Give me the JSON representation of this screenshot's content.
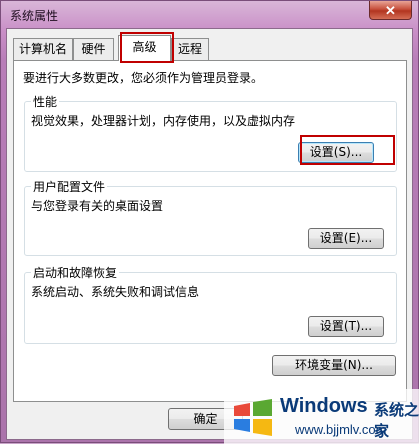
{
  "window": {
    "title": "系统属性",
    "close_label": "✕"
  },
  "tabs": [
    {
      "label": "计算机名"
    },
    {
      "label": "硬件"
    },
    {
      "label": "高级"
    },
    {
      "label": "远程"
    }
  ],
  "panel": {
    "intro": "要进行大多数更改，您必须作为管理员登录。",
    "groups": [
      {
        "title": "性能",
        "desc": "视觉效果，处理器计划，内存使用，以及虚拟内存",
        "button": "设置(S)..."
      },
      {
        "title": "用户配置文件",
        "desc": "与您登录有关的桌面设置",
        "button": "设置(E)..."
      },
      {
        "title": "启动和故障恢复",
        "desc": "系统启动、系统失败和调试信息",
        "button": "设置(T)..."
      }
    ],
    "env_button": "环境变量(N)..."
  },
  "footer": {
    "ok_button": "确定"
  },
  "watermark": {
    "brand": "Windows",
    "cn": "系统之家",
    "url": "www.bjjmlv.com"
  },
  "colors": {
    "highlight": "#c00000",
    "brand": "#0a3a78"
  }
}
